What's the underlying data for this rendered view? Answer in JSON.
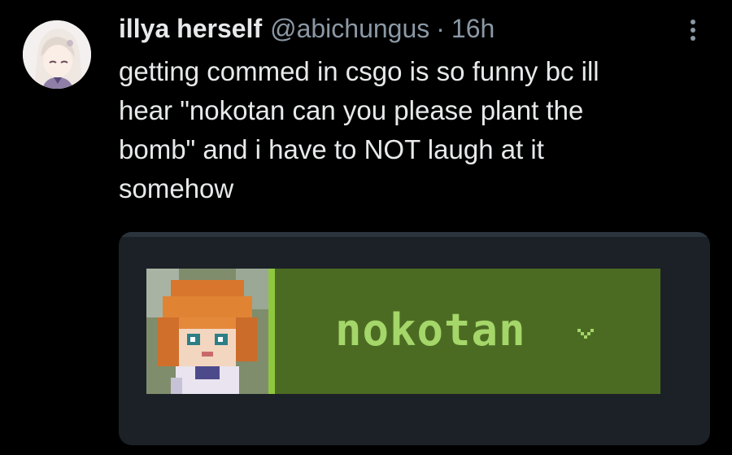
{
  "tweet": {
    "display_name": "illya herself",
    "handle": "@abichungus",
    "separator": "·",
    "time": "16h",
    "text": "getting commed in csgo is so funny bc ill\nhear \"nokotan can you please plant the\nbomb\" and i have to NOT laugh at it\nsomehow",
    "more_icon": "more-vertical-icon"
  },
  "media": {
    "username": "nokotan",
    "dropdown_icon": "chevron-down-icon"
  },
  "colors": {
    "background": "#000000",
    "text": "#e7e9ea",
    "secondary_text": "#8b98a5",
    "card_background": "#1c2127",
    "panel_green": "#4c6b22",
    "accent_green": "#8fc73e",
    "username_green": "#a4d66a"
  }
}
